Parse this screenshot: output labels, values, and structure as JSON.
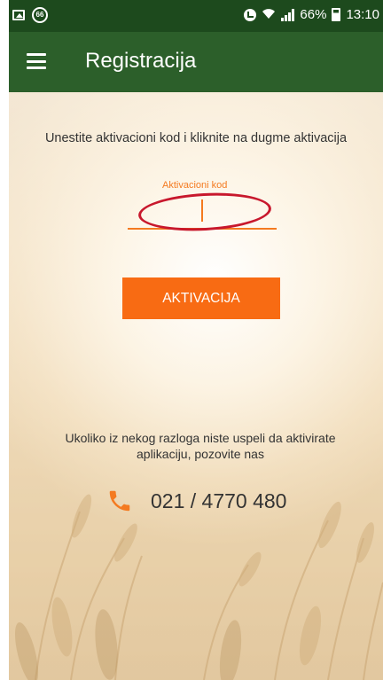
{
  "status_bar": {
    "notification_badge": "66",
    "battery_percent": "66%",
    "time": "13:10"
  },
  "app_bar": {
    "title": "Registracija"
  },
  "main": {
    "instruction": "Unestite aktivacioni kod i kliknite na dugme aktivacija",
    "code_field": {
      "label": "Aktivacioni kod",
      "value": "",
      "placeholder": ""
    },
    "activate_button": "AKTIVACIJA",
    "help_text": "Ukoliko iz nekog razloga niste uspeli da aktivirate aplikaciju, pozovite nas",
    "phone": "021 / 4770 480"
  },
  "colors": {
    "status_bar": "#1d4a1d",
    "app_bar": "#2c5f2a",
    "accent": "#f86b13",
    "annotation_ring": "#c8182d"
  },
  "icons": {
    "status_left": [
      "gallery-icon",
      "notification-badge-icon"
    ],
    "status_right": [
      "alarm-icon",
      "wifi-icon",
      "signal-icon",
      "battery-icon"
    ],
    "menu": "hamburger-menu-icon",
    "phone": "phone-icon"
  }
}
